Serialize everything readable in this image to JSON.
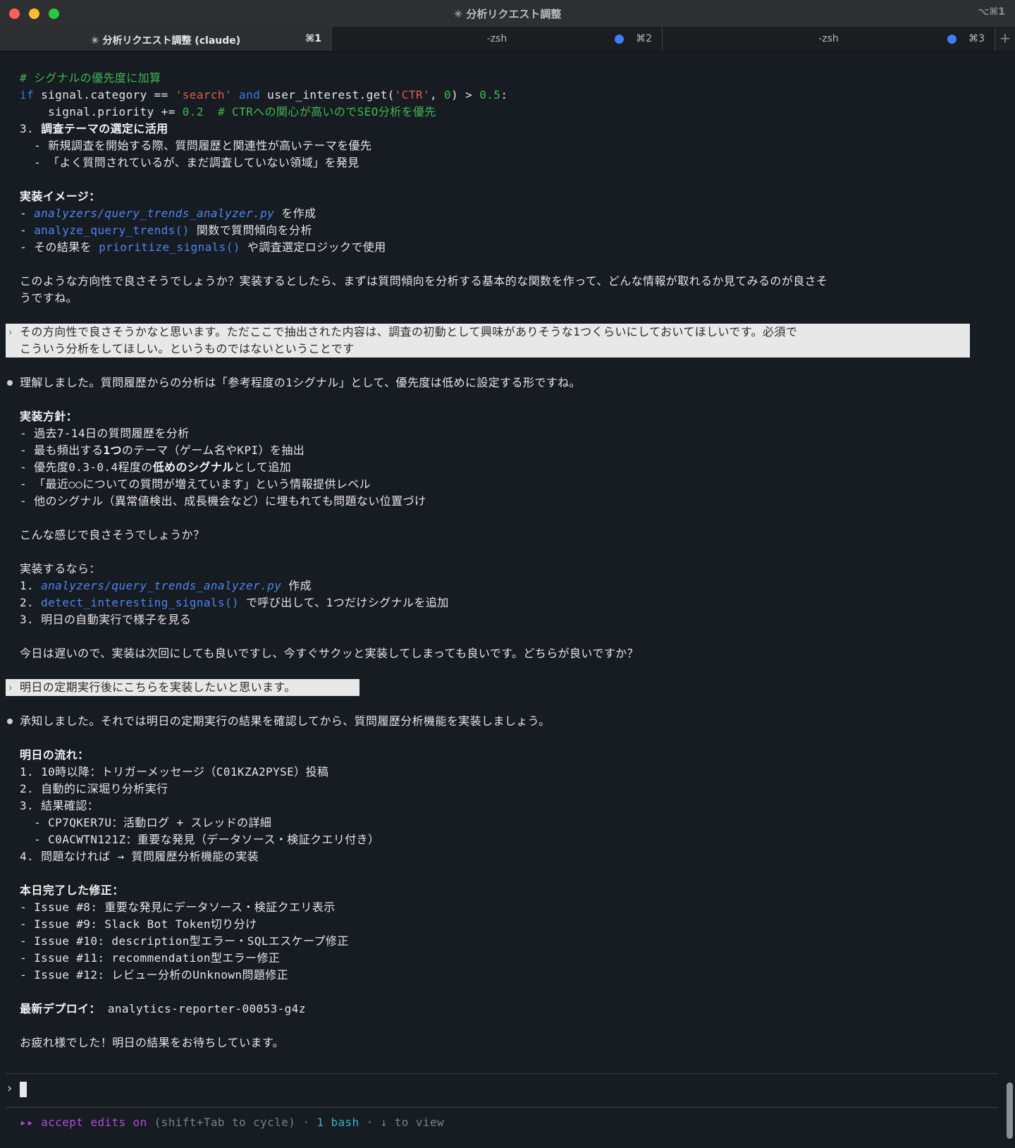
{
  "window": {
    "title": "✳ 分析リクエスト調整",
    "shortcut": "⌥⌘1"
  },
  "tabs": [
    {
      "label": "✳ 分析リクエスト調整 (claude)",
      "shortcut": "⌘1",
      "active": true
    },
    {
      "label": "-zsh",
      "shortcut": "⌘2",
      "active": false
    },
    {
      "label": "-zsh",
      "shortcut": "⌘3",
      "active": false
    }
  ],
  "transcript": {
    "code_comment": "# シグナルの優先度に加算",
    "code_if": {
      "kw_if": "if",
      "part1": " signal.category == ",
      "str_search": "'search'",
      "kw_and": " and ",
      "part2": "user_interest.get(",
      "str_ctr": "'CTR'",
      "comma": ", ",
      "num0": "0",
      "part3": ") > ",
      "num05": "0.5",
      "colon": ":"
    },
    "code_priority": {
      "part": "    signal.priority += ",
      "num": "0.2",
      "comment": "  # CTRへの関心が高いのでSEO分析を優先"
    },
    "item3": {
      "prefix": "3. ",
      "bold": "調査テーマの選定に活用"
    },
    "item3_sub1": "  - 新規調査を開始する際、質問履歴と関連性が高いテーマを優先",
    "item3_sub2": "  - 「よく質問されているが、まだ調査していない領域」を発見",
    "impl_image_heading": "実装イメージ：",
    "impl1": {
      "prefix": "- ",
      "code": "analyzers/query_trends_analyzer.py",
      "suffix": " を作成"
    },
    "impl2": {
      "prefix": "- ",
      "code": "analyze_query_trends()",
      "suffix": " 関数で質問傾向を分析"
    },
    "impl3": {
      "prefix": "- その結果を ",
      "code": "prioritize_signals()",
      "suffix": " や調査選定ロジックで使用"
    },
    "question1_l1": "このような方向性で良さそうでしょうか？実装するとしたら、まずは質問傾向を分析する基本的な関数を作って、どんな情報が取れるか見てみるのが良さそ",
    "question1_l2": "うですね。",
    "user1_l1": "その方向性で良さそうかなと思います。ただここで抽出された内容は、調査の初動として興味がありそうな1つくらいにしておいてほしいです。必須で",
    "user1_l2": "こういう分析をしてほしい。というものではないということです",
    "reply1": "理解しました。質問履歴からの分析は「参考程度の1シグナル」として、優先度は低めに設定する形ですね。",
    "policy_heading": "実装方針：",
    "policy1": "- 過去7-14日の質問履歴を分析",
    "policy2": {
      "prefix": "- 最も頻出する",
      "bold": "1つ",
      "suffix": "のテーマ（ゲーム名やKPI）を抽出"
    },
    "policy3": {
      "prefix": "- 優先度0.3-0.4程度の",
      "bold": "低めのシグナル",
      "suffix": "として追加"
    },
    "policy4": "- 「最近○○についての質問が増えています」という情報提供レベル",
    "policy5": "- 他のシグナル（異常値検出、成長機会など）に埋もれても問題ない位置づけ",
    "ok_question": "こんな感じで良さそうでしょうか？",
    "if_impl": "実装するなら：",
    "step1": {
      "prefix": "1. ",
      "code": "analyzers/query_trends_analyzer.py",
      "suffix": " 作成"
    },
    "step2": {
      "prefix": "2. ",
      "code": "detect_interesting_signals()",
      "suffix": " で呼び出して、1つだけシグナルを追加"
    },
    "step3": "3. 明日の自動実行で様子を見る",
    "today_question": "今日は遅いので、実装は次回にしても良いですし、今すぐサクッと実装してしまっても良いです。どちらが良いですか？",
    "user2": "明日の定期実行後にこちらを実装したいと思います。",
    "reply2": "承知しました。それでは明日の定期実行の結果を確認してから、質問履歴分析機能を実装しましょう。",
    "tomorrow_heading": "明日の流れ：",
    "flow1": "1. 10時以降：トリガーメッセージ（C01KZA2PYSE）投稿",
    "flow2": "2. 自動的に深堀り分析実行",
    "flow3": "3. 結果確認：",
    "flow3_sub1": "  - CP7QKER7U：活動ログ + スレッドの詳細",
    "flow3_sub2": "  - C0ACWTN121Z：重要な発見（データソース・検証クエリ付き）",
    "flow4": "4. 問題なければ → 質問履歴分析機能の実装",
    "fixes_heading": "本日完了した修正：",
    "fix8": "- Issue #8: 重要な発見にデータソース・検証クエリ表示",
    "fix9": "- Issue #9: Slack Bot Token切り分け",
    "fix10": "- Issue #10: description型エラー・SQLエスケープ修正",
    "fix11": "- Issue #11: recommendation型エラー修正",
    "fix12": "- Issue #12: レビュー分析のUnknown問題修正",
    "deploy_label": "最新デプロイ：",
    "deploy_value": " analytics-reporter-00053-g4z",
    "farewell": "お疲れ様でした！明日の結果をお待ちしています。"
  },
  "input": {
    "prompt_char": "›"
  },
  "status_bar": {
    "arrows": "▸▸",
    "mode": " accept edits on",
    "hint": " (shift+Tab to cycle) · ",
    "bash": "1 bash",
    "view": " · ↓ to view"
  },
  "colors": {
    "background": "#171b22",
    "comment_green": "#3fb950",
    "keyword_blue": "#3a7be0",
    "string_red": "#e05c4f",
    "path_blue": "#4d86f0",
    "user_block_bg": "#e8e8e8",
    "mode_magenta": "#b04bd6",
    "bash_cyan": "#33b3c7",
    "tab_dot_blue": "#3f7ef6"
  }
}
